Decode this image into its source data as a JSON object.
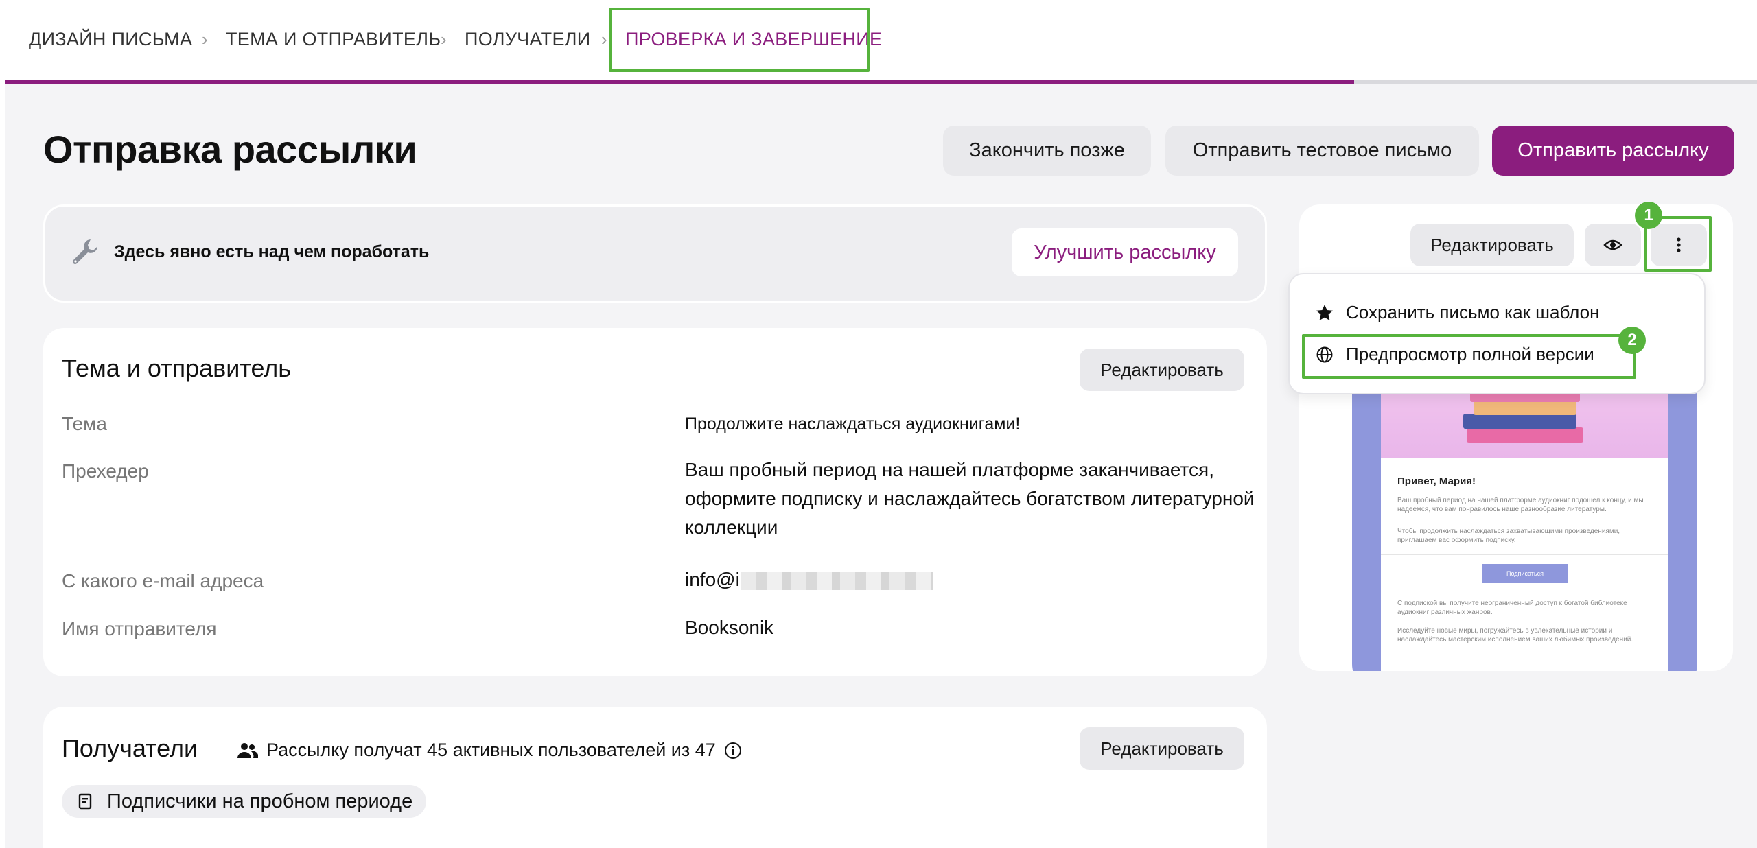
{
  "breadcrumbs": [
    {
      "label": "ДИЗАЙН ПИСЬМА"
    },
    {
      "label": "ТЕМА И ОТПРАВИТЕЛЬ"
    },
    {
      "label": "ПОЛУЧАТЕЛИ"
    },
    {
      "label": "ПРОВЕРКА И ЗАВЕРШЕНИЕ"
    }
  ],
  "progress": 0.77,
  "header": {
    "title": "Отправка рассылки",
    "finish_later": "Закончить позже",
    "send_test": "Отправить тестовое письмо",
    "send": "Отправить рассылку"
  },
  "banner": {
    "text": "Здесь явно есть над чем поработать",
    "improve": "Улучшить рассылку"
  },
  "subject_card": {
    "title": "Тема и отправитель",
    "edit": "Редактировать",
    "rows": [
      {
        "label": "Тема",
        "value": "Продолжите наслаждаться аудиокнигами!"
      },
      {
        "label": "Прехедер",
        "value": "Ваш пробный период на нашей платформе заканчивается, оформите подписку и наслаждайтесь богатством литературной коллекции"
      },
      {
        "label": "С какого e-mail адреса",
        "value": "info@i"
      },
      {
        "label": "Имя отправителя",
        "value": "Booksonik"
      }
    ]
  },
  "recipients_card": {
    "title": "Получатели",
    "info": "Рассылку получат 45 активных пользователей из 47",
    "edit": "Редактировать",
    "segment": "Подписчики на пробном периоде"
  },
  "preview": {
    "edit": "Редактировать",
    "menu": {
      "save_template": "Сохранить письмо как шаблон",
      "full_preview": "Предпросмотр полной версии"
    },
    "email": {
      "greeting": "Привет, Мария!",
      "p1": "Ваш пробный период на нашей платформе аудиокниг подошел к концу, и мы надеемся, что вам понравилось наше разнообразие литературы.",
      "p2": "Чтобы продолжить наслаждаться захватывающими произведениями, приглашаем вас оформить подписку.",
      "button": "Подписаться",
      "p3": "С подпиской вы получите неограниченный доступ к богатой библиотеке аудиокниг различных жанров.",
      "p4": "Исследуйте новые миры, погружайтесь в увлекательные истории и наслаждайтесь мастерским исполнением ваших любимых произведений."
    }
  },
  "annotations": {
    "badge1": "1",
    "badge2": "2"
  },
  "colors": {
    "brand": "#8b1d7e",
    "highlight": "#56b33c"
  }
}
